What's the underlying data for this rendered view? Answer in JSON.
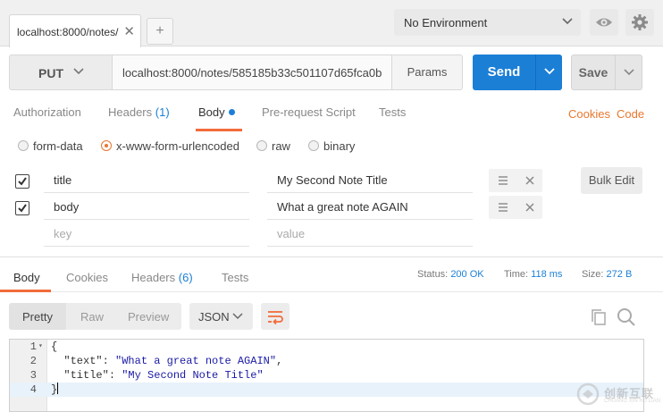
{
  "tabs": {
    "active_label": "localhost:8000/notes/",
    "close_glyph": "✕",
    "new_tab_glyph": "+"
  },
  "environment": {
    "selected": "No Environment"
  },
  "request": {
    "method": "PUT",
    "url": "localhost:8000/notes/585185b33c501107d65fca0b",
    "params_label": "Params",
    "send_label": "Send",
    "save_label": "Save"
  },
  "request_tabs": {
    "authorization": "Authorization",
    "headers": "Headers",
    "headers_count": "(1)",
    "body": "Body",
    "pre_request": "Pre-request Script",
    "tests": "Tests",
    "cookies": "Cookies",
    "code": "Code"
  },
  "body_modes": {
    "form_data": "form-data",
    "urlencoded": "x-www-form-urlencoded",
    "raw": "raw",
    "binary": "binary",
    "selected": "x-www-form-urlencoded"
  },
  "params": {
    "rows": [
      {
        "key": "title",
        "value": "My Second Note Title",
        "checked": true
      },
      {
        "key": "body",
        "value": "What a great note AGAIN",
        "checked": true
      }
    ],
    "key_placeholder": "key",
    "value_placeholder": "value",
    "bulk_edit_label": "Bulk Edit"
  },
  "response_tabs": {
    "body": "Body",
    "cookies": "Cookies",
    "headers": "Headers",
    "headers_count": "(6)",
    "tests": "Tests"
  },
  "response_status": {
    "status_label": "Status:",
    "status_value": "200 OK",
    "time_label": "Time:",
    "time_value": "118 ms",
    "size_label": "Size:",
    "size_value": "272 B"
  },
  "viewer": {
    "pretty": "Pretty",
    "raw": "Raw",
    "preview": "Preview",
    "format": "JSON"
  },
  "response_body": {
    "line_numbers": [
      "1",
      "2",
      "3",
      "4"
    ],
    "open_brace": "{",
    "line2_key": "\"text\"",
    "line2_sep": ": ",
    "line2_value": "\"What a great note AGAIN\"",
    "line2_comma": ",",
    "line3_key": "\"title\"",
    "line3_sep": ": ",
    "line3_value": "\"My Second Note Title\"",
    "close_brace": "}"
  },
  "watermark": {
    "title": "创新互联",
    "subtitle": "CHUANG XIN HU LIAN"
  },
  "colors": {
    "accent_blue": "#1b7fd6",
    "accent_orange": "#f26b3a"
  },
  "icons": [
    "close-icon",
    "plus-icon",
    "chevron-down-icon",
    "eye-icon",
    "gear-icon",
    "checkbox-checked-icon",
    "drag-handle-icon",
    "remove-icon",
    "wrap-lines-icon",
    "copy-icon",
    "search-icon"
  ]
}
